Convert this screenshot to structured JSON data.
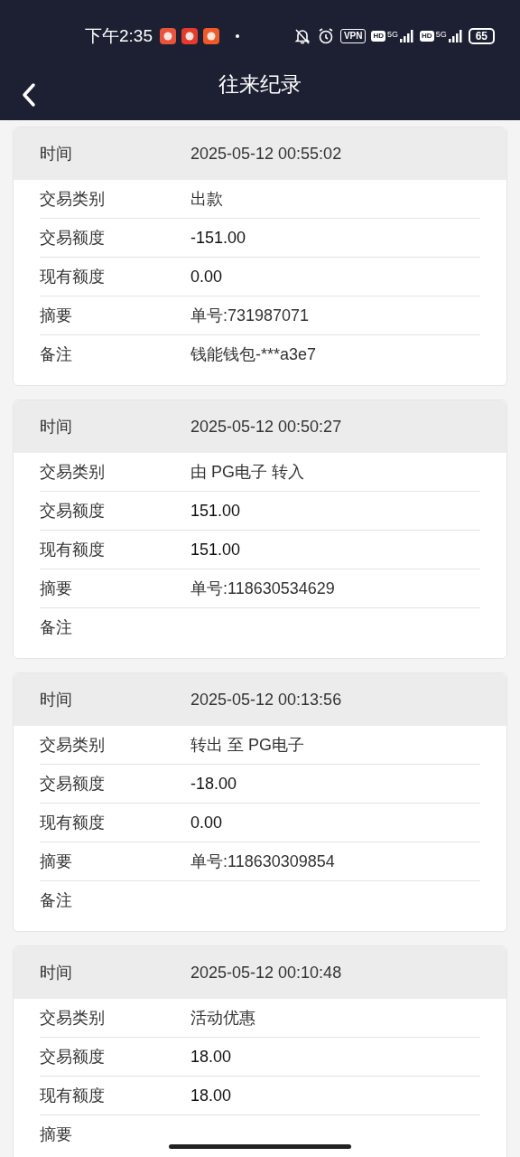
{
  "status_bar": {
    "time": "下午2:35",
    "vpn": "VPN",
    "sims": [
      {
        "hd": "HD",
        "net": "5G"
      },
      {
        "hd": "HD",
        "net": "5G"
      }
    ],
    "battery": "65"
  },
  "header": {
    "title": "往来纪录"
  },
  "records": [
    {
      "time_label": "时间",
      "time": "2025-05-12 00:55:02",
      "rows": [
        {
          "label": "交易类别",
          "value": "出款",
          "kind": "text"
        },
        {
          "label": "交易额度",
          "value": "-151.00",
          "kind": "amount"
        },
        {
          "label": "现有额度",
          "value": "0.00",
          "kind": "amount"
        },
        {
          "label": "摘要",
          "value": "单号:731987071",
          "kind": "text"
        },
        {
          "label": "备注",
          "value": "钱能钱包-***a3e7",
          "kind": "text"
        }
      ]
    },
    {
      "time_label": "时间",
      "time": "2025-05-12 00:50:27",
      "rows": [
        {
          "label": "交易类别",
          "value": "由 PG电子 转入",
          "kind": "text"
        },
        {
          "label": "交易额度",
          "value": "151.00",
          "kind": "amount"
        },
        {
          "label": "现有额度",
          "value": "151.00",
          "kind": "amount"
        },
        {
          "label": "摘要",
          "value": "单号:118630534629",
          "kind": "text"
        },
        {
          "label": "备注"
        }
      ]
    },
    {
      "time_label": "时间",
      "time": "2025-05-12 00:13:56",
      "rows": [
        {
          "label": "交易类别",
          "value": "转出 至 PG电子",
          "kind": "text"
        },
        {
          "label": "交易额度",
          "value": "-18.00",
          "kind": "amount"
        },
        {
          "label": "现有额度",
          "value": "0.00",
          "kind": "amount"
        },
        {
          "label": "摘要",
          "value": "单号:118630309854",
          "kind": "text"
        },
        {
          "label": "备注"
        }
      ]
    },
    {
      "time_label": "时间",
      "time": "2025-05-12 00:10:48",
      "rows": [
        {
          "label": "交易类别",
          "value": "活动优惠",
          "kind": "text"
        },
        {
          "label": "交易额度",
          "value": "18.00",
          "kind": "amount"
        },
        {
          "label": "现有额度",
          "value": "18.00",
          "kind": "amount"
        },
        {
          "label": "摘要"
        }
      ]
    }
  ]
}
